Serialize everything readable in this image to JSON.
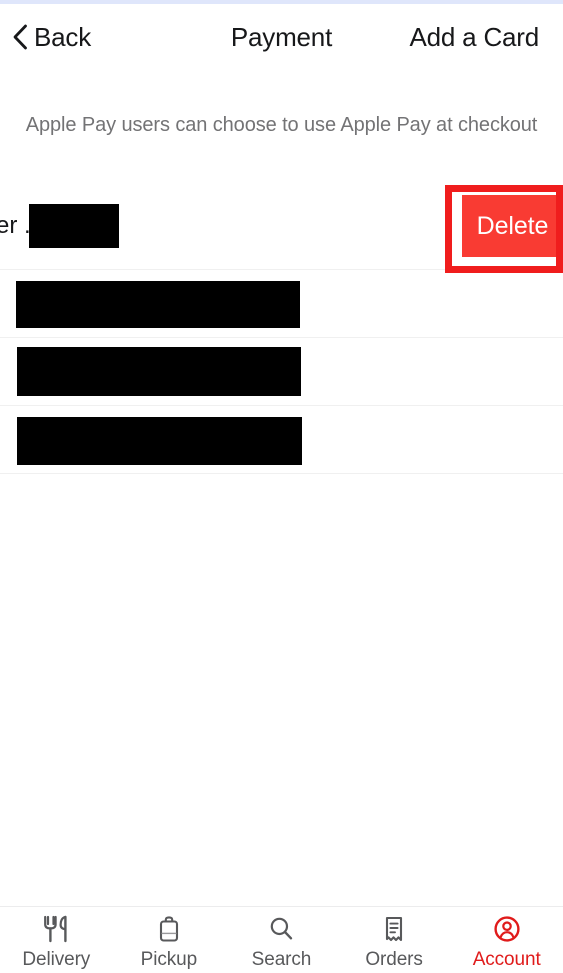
{
  "header": {
    "back_label": "Back",
    "back_icon": "chevron-left-icon",
    "title": "Payment",
    "add_card_label": "Add a Card"
  },
  "content": {
    "apple_pay_note": "Apple Pay users can choose to use Apple Pay at checkout"
  },
  "cards": [
    {
      "visible_text": "er ..",
      "redacted": true
    },
    {
      "visible_text": "",
      "redacted": true
    },
    {
      "visible_text": "",
      "redacted": true
    },
    {
      "visible_text": "",
      "redacted": true
    }
  ],
  "swipe_action": {
    "delete_label": "Delete",
    "delete_bg": "#f93b33",
    "delete_text_color": "#ffffff"
  },
  "annotation": {
    "color": "#f01d1d",
    "target": "delete-button"
  },
  "tab_bar": {
    "active_color": "#e01b1b",
    "inactive_color": "#58595b",
    "items": [
      {
        "label": "Delivery",
        "icon": "cutlery-icon",
        "active": false
      },
      {
        "label": "Pickup",
        "icon": "shopping-bag-icon",
        "active": false
      },
      {
        "label": "Search",
        "icon": "search-icon",
        "active": false
      },
      {
        "label": "Orders",
        "icon": "receipt-icon",
        "active": false
      },
      {
        "label": "Account",
        "icon": "account-circle-icon",
        "active": true
      }
    ]
  },
  "colors": {
    "top_hairline": "#dfe6fb",
    "separator": "#f0f0f0",
    "muted_text": "#737375",
    "primary_text": "#17181a"
  }
}
